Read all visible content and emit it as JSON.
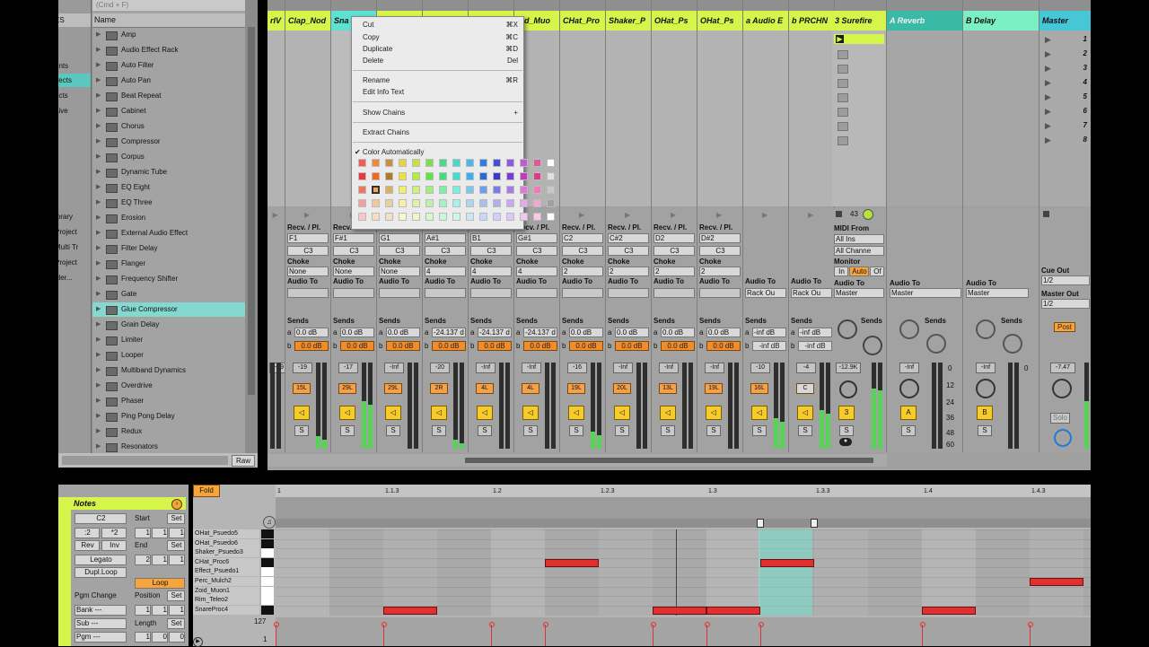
{
  "browser": {
    "places_header": "ES",
    "places": [
      {
        "label": "ents",
        "selected": false
      },
      {
        "label": "ffects",
        "selected": true
      },
      {
        "label": "ects",
        "selected": false
      },
      {
        "label": "Live",
        "selected": false
      },
      {
        "label": "ibrary",
        "selected": false
      },
      {
        "label": "Project",
        "selected": false
      },
      {
        "label": "Multi Tr",
        "selected": false
      },
      {
        "label": "Project",
        "selected": false
      },
      {
        "label": "lder...",
        "selected": false
      }
    ],
    "search_hint": "(Cmd + F)",
    "name_header": "Name",
    "items": [
      {
        "label": "Amp",
        "selected": false
      },
      {
        "label": "Audio Effect Rack",
        "selected": false
      },
      {
        "label": "Auto Filter",
        "selected": false
      },
      {
        "label": "Auto Pan",
        "selected": false
      },
      {
        "label": "Beat Repeat",
        "selected": false
      },
      {
        "label": "Cabinet",
        "selected": false
      },
      {
        "label": "Chorus",
        "selected": false
      },
      {
        "label": "Compressor",
        "selected": false
      },
      {
        "label": "Corpus",
        "selected": false
      },
      {
        "label": "Dynamic Tube",
        "selected": false
      },
      {
        "label": "EQ Eight",
        "selected": false
      },
      {
        "label": "EQ Three",
        "selected": false
      },
      {
        "label": "Erosion",
        "selected": false
      },
      {
        "label": "External Audio Effect",
        "selected": false
      },
      {
        "label": "Filter Delay",
        "selected": false
      },
      {
        "label": "Flanger",
        "selected": false
      },
      {
        "label": "Frequency Shifter",
        "selected": false
      },
      {
        "label": "Gate",
        "selected": false
      },
      {
        "label": "Glue Compressor",
        "selected": true
      },
      {
        "label": "Grain Delay",
        "selected": false
      },
      {
        "label": "Limiter",
        "selected": false
      },
      {
        "label": "Looper",
        "selected": false
      },
      {
        "label": "Multiband Dynamics",
        "selected": false
      },
      {
        "label": "Overdrive",
        "selected": false
      },
      {
        "label": "Phaser",
        "selected": false
      },
      {
        "label": "Ping Pong Delay",
        "selected": false
      },
      {
        "label": "Redux",
        "selected": false
      },
      {
        "label": "Resonators",
        "selected": false
      }
    ],
    "raw_button": "Raw"
  },
  "tracks": [
    {
      "name": "rIV",
      "color": "#d6f54a",
      "recv": "",
      "note": "",
      "choke": "",
      "vol": "-19",
      "pan": "",
      "act": "",
      "meter": 0.0
    },
    {
      "name": "Clap_Nod",
      "color": "#d6f54a",
      "recv": "F1",
      "note": "C3",
      "choke": "None",
      "vol": "-19",
      "pan": "15L",
      "act": "◁",
      "meter": 0.15
    },
    {
      "name": "Sna",
      "color": "#5ee0d2",
      "recv": "F#1",
      "note": "C3",
      "choke": "None",
      "vol": "-17",
      "pan": "29L",
      "act": "◁",
      "meter": 0.55
    },
    {
      "name": "",
      "color": "#d6f54a",
      "recv": "G1",
      "note": "C3",
      "choke": "None",
      "vol": "-Inf",
      "pan": "29L",
      "act": "◁",
      "meter": 0.0
    },
    {
      "name": "",
      "color": "#d6f54a",
      "recv": "A#1",
      "note": "C3",
      "choke": "4",
      "vol": "-20",
      "pan": "2R",
      "act": "◁",
      "meter": 0.1
    },
    {
      "name": "",
      "color": "#d6f54a",
      "recv": "B1",
      "note": "C3",
      "choke": "4",
      "vol": "-Inf",
      "pan": "4L",
      "act": "◁",
      "meter": 0.0
    },
    {
      "name": "oid_Muo",
      "color": "#d6f54a",
      "recv": "G#1",
      "note": "C3",
      "choke": "4",
      "vol": "-Inf",
      "pan": "4L",
      "act": "◁",
      "meter": 0.0
    },
    {
      "name": "CHat_Pro",
      "color": "#d6f54a",
      "recv": "C2",
      "note": "C3",
      "choke": "2",
      "vol": "-16",
      "pan": "19L",
      "act": "◁",
      "meter": 0.2
    },
    {
      "name": "Shaker_P",
      "color": "#d6f54a",
      "recv": "C#2",
      "note": "C3",
      "choke": "2",
      "vol": "-Inf",
      "pan": "20L",
      "act": "◁",
      "meter": 0.0
    },
    {
      "name": "OHat_Ps",
      "color": "#d6f54a",
      "recv": "D2",
      "note": "C3",
      "choke": "2",
      "vol": "-Inf",
      "pan": "13L",
      "act": "◁",
      "meter": 0.0
    },
    {
      "name": "OHat_Ps",
      "color": "#d6f54a",
      "recv": "D#2",
      "note": "C3",
      "choke": "2",
      "vol": "-Inf",
      "pan": "19L",
      "act": "◁",
      "meter": 0.0
    },
    {
      "name": "a Audio E",
      "color": "#d6f54a",
      "recv": "",
      "note": "",
      "choke": "",
      "vol": "-10",
      "pan": "16L",
      "act": "◁",
      "meter": 0.35
    },
    {
      "name": "b PRCHN",
      "color": "#d6f54a",
      "recv": "",
      "note": "",
      "choke": "",
      "vol": "-4",
      "pan": "C",
      "act": "◁",
      "meter": 0.45
    }
  ],
  "context_menu": {
    "items": [
      {
        "label": "Cut",
        "shortcut": "⌘X"
      },
      {
        "label": "Copy",
        "shortcut": "⌘C"
      },
      {
        "label": "Duplicate",
        "shortcut": "⌘D"
      },
      {
        "label": "Delete",
        "shortcut": "Del"
      },
      {
        "label": "Rename",
        "shortcut": "⌘R"
      },
      {
        "label": "Edit Info Text",
        "shortcut": ""
      },
      {
        "label": "Show Chains",
        "shortcut": "+"
      },
      {
        "label": "Extract Chains",
        "shortcut": ""
      },
      {
        "label": "✔ Color Automatically",
        "shortcut": ""
      }
    ],
    "palette": [
      [
        "#f05a5a",
        "#f08a3a",
        "#c89040",
        "#e6d34a",
        "#c8e046",
        "#7be04a",
        "#4ad88a",
        "#46d8c8",
        "#4ab8e8",
        "#2a80e8",
        "#4050d8",
        "#8a5ae0",
        "#c05ad0",
        "#e05a9a",
        "#ffffff"
      ],
      [
        "#e83a3a",
        "#f06a1a",
        "#b07a28",
        "#f0e03a",
        "#b0f03a",
        "#5ae83a",
        "#3ae07a",
        "#3ae0d8",
        "#3ab0f0",
        "#2a6ad8",
        "#3a3ac8",
        "#7a3ad8",
        "#c03ac0",
        "#e03a8a",
        "#e0e0e0"
      ],
      [
        "#f0785a",
        "#f0a85a",
        "#d8b060",
        "#f0f06a",
        "#d0f07a",
        "#a0f07a",
        "#7af0a8",
        "#7af0e0",
        "#7ac8f0",
        "#6aa0f0",
        "#7a7ae8",
        "#a87ae8",
        "#d87ad8",
        "#f07ab8",
        "#c8c8c8"
      ],
      [
        "#f0a0a0",
        "#f0c8a0",
        "#e8d0a0",
        "#f8f0a8",
        "#e0f0a8",
        "#c0f0a8",
        "#a8f0c8",
        "#a8f0e8",
        "#a8d8f0",
        "#a8c0f0",
        "#b0b0f0",
        "#c8a8f0",
        "#e8a8e8",
        "#f0a8d0",
        "#a0a0a0"
      ],
      [
        "#f8c8c8",
        "#f8dcc8",
        "#f0e0c8",
        "#f8f8c8",
        "#ecf8c8",
        "#d8f8c8",
        "#c8f8dc",
        "#c8f8f0",
        "#c8e8f8",
        "#c8d8f8",
        "#d0d0f8",
        "#dcc8f8",
        "#f0c8f0",
        "#f8c8e4",
        "#ffffff"
      ]
    ]
  },
  "returns": {
    "surefire": {
      "name": "3 Surefire",
      "midi_from": "MIDI From",
      "midi_src": "All Ins",
      "channel": "All Channe",
      "monitor": "Monitor",
      "mon_in": "In",
      "mon_auto": "Auto",
      "mon_off": "Of",
      "audio_to": "Audio To",
      "audio_dest": "Master",
      "vol": "-12.9K",
      "act": "3",
      "num": "43"
    },
    "reverb": {
      "name": "A Reverb",
      "audio_to": "Audio To",
      "audio_dest": "Master",
      "vol": "-Inf",
      "act": "A"
    },
    "delay": {
      "name": "B Delay",
      "audio_to": "Audio To",
      "audio_dest": "Master",
      "vol": "-Inf",
      "act": "B"
    },
    "master": {
      "name": "Master",
      "scenes": [
        "1",
        "2",
        "3",
        "4",
        "5",
        "6",
        "7",
        "8"
      ],
      "cue_out": "Cue Out",
      "cue_val": "1/2",
      "master_out": "Master Out",
      "master_val": "1/2",
      "vol": "-7.47",
      "post": "Post",
      "solo": "Solo"
    }
  },
  "labels": {
    "recv": "Recv. / Pl.",
    "choke": "Choke",
    "audio_to": "Audio To",
    "sends": "Sends",
    "send_a": "0.0 dB",
    "send_b": "0.0 dB",
    "rack_out": "Rack Ou",
    "send_alt": "-24.137 d",
    "send_inf": "-inf dB"
  },
  "meter_scale": [
    "0",
    "12",
    "24",
    "36",
    "48",
    "60"
  ],
  "clip": {
    "notes_title": "Notes",
    "fold": "Fold",
    "key": "C2",
    "start": "Start",
    "set": "Set",
    "end": "End",
    "div2": ":2",
    "mul2": "*2",
    "rev": "Rev",
    "inv": "Inv",
    "legato": "Legato",
    "dupl": "Dupl.Loop",
    "loop": "Loop",
    "pgm": "Pgm Change",
    "position": "Position",
    "bank": "Bank ---",
    "sub": "Sub ---",
    "pgm_v": "Pgm ---",
    "length": "Length",
    "start_v": [
      "1",
      "1",
      "1"
    ],
    "end_v": [
      "2",
      "1",
      "1"
    ],
    "pos_v": [
      "1",
      "1",
      "1"
    ],
    "len_v": [
      "1",
      "0",
      "0"
    ]
  },
  "timeline": [
    "1",
    "1.1.3",
    "1.2",
    "1.2.3",
    "1.3",
    "1.3.3",
    "1.4",
    "1.4.3"
  ],
  "keys": [
    "OHat_Psuedo5",
    "OHat_Psuedo6",
    "Shaker_Psuedo3",
    "CHat_Proc6",
    "Effect_Psuedo1",
    "Perc_Mulch2",
    "Zoid_Muon1",
    "Rim_Teleo2",
    "SnareProc4"
  ],
  "velocity_max": "127",
  "velocity_min": "1"
}
